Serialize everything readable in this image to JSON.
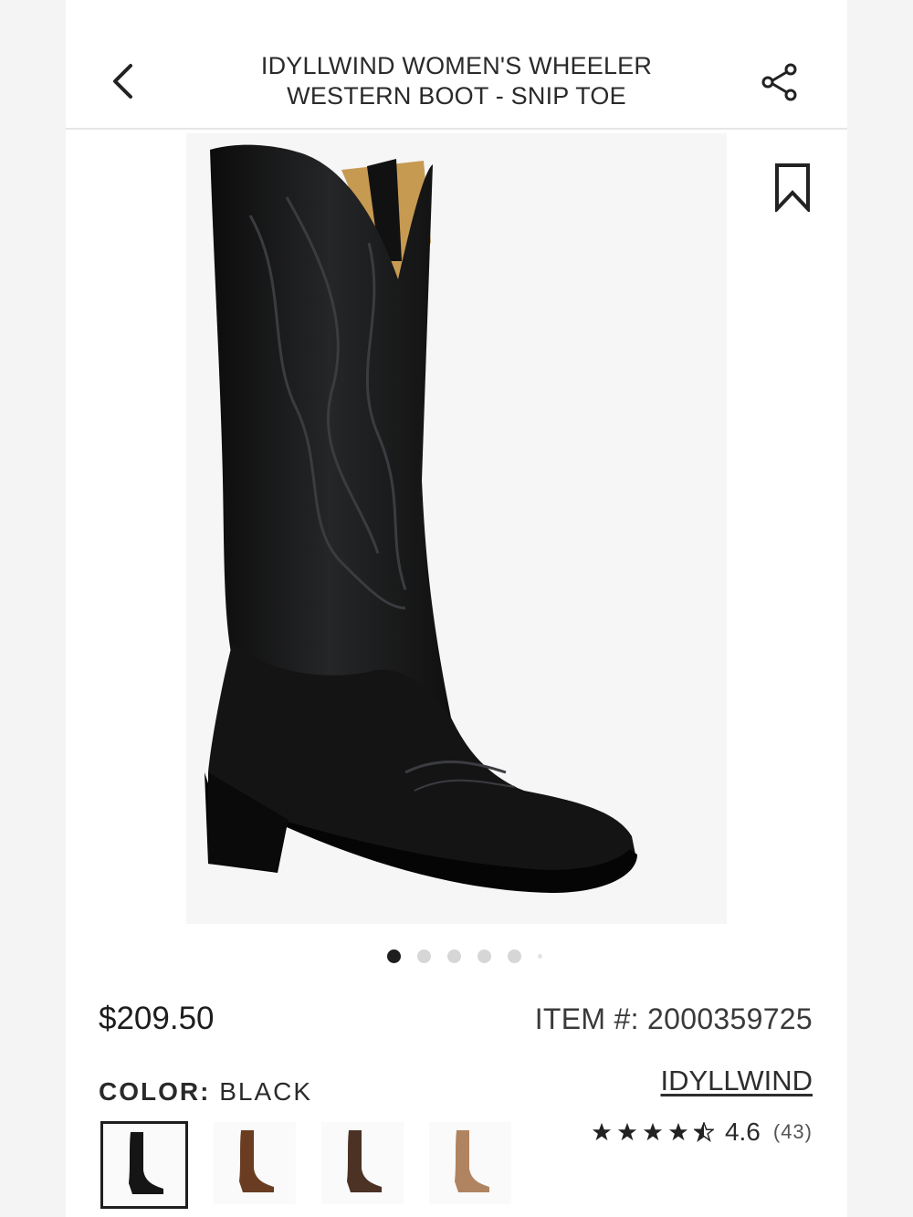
{
  "header": {
    "title_line1": "IDYLLWIND WOMEN'S WHEELER",
    "title_line2": "WESTERN BOOT - SNIP TOE",
    "back_icon": "chevron-left-icon",
    "share_icon": "share-icon"
  },
  "gallery": {
    "bookmark_icon": "bookmark-icon",
    "pager": {
      "total_dots": 6,
      "active_index": 0
    }
  },
  "product": {
    "price": "$209.50",
    "item_number": "ITEM #: 2000359725",
    "color_label": "COLOR:",
    "color_value": "BLACK",
    "brand": "IDYLLWIND",
    "rating_value": "4.6",
    "rating_count": "(43)",
    "rating_stars": 4.5
  },
  "swatches": [
    {
      "name": "black",
      "color": "#151515",
      "selected": true
    },
    {
      "name": "brown",
      "color": "#6a3d22",
      "selected": false
    },
    {
      "name": "dark-brown",
      "color": "#4b3224",
      "selected": false
    },
    {
      "name": "tan",
      "color": "#b08460",
      "selected": false
    }
  ]
}
